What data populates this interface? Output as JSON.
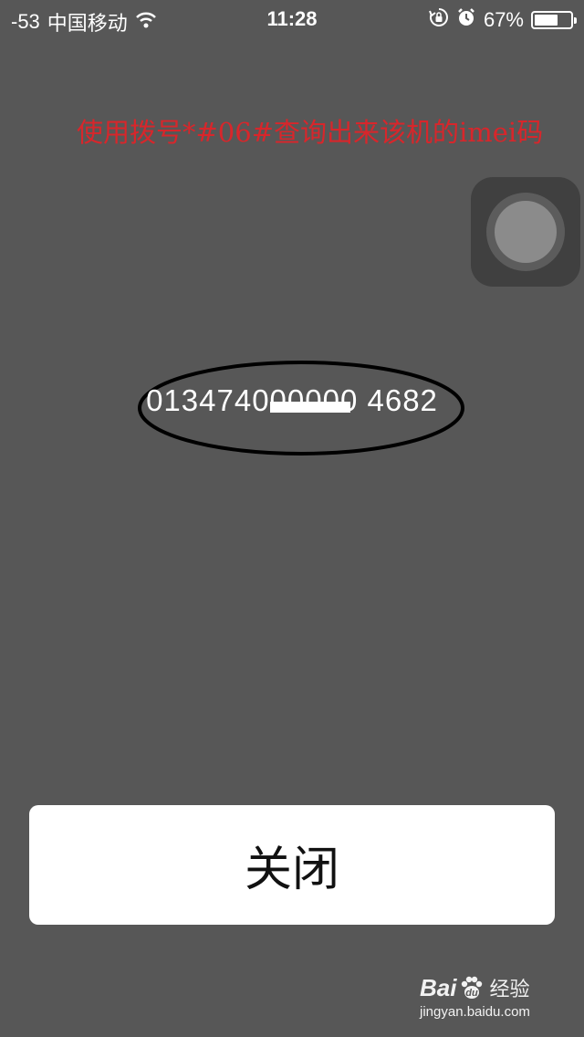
{
  "status_bar": {
    "signal": "-53",
    "carrier": "中国移动",
    "time": "11:28",
    "battery": "67%",
    "battery_level": 0.67,
    "icons": [
      "wifi-icon",
      "rotation-lock-icon",
      "alarm-icon",
      "battery-icon"
    ]
  },
  "annotation": {
    "text": "使用拨号*#06#查询出来该机的imei码",
    "color": "#d8262b"
  },
  "imei": {
    "value": "013474000000 4682"
  },
  "close_button": {
    "label": "关闭"
  },
  "watermark": {
    "brand_left": "Bai",
    "brand_right": "经验",
    "url": "jingyan.baidu.com"
  },
  "colors": {
    "background": "#575757",
    "button": "#ffffff"
  }
}
